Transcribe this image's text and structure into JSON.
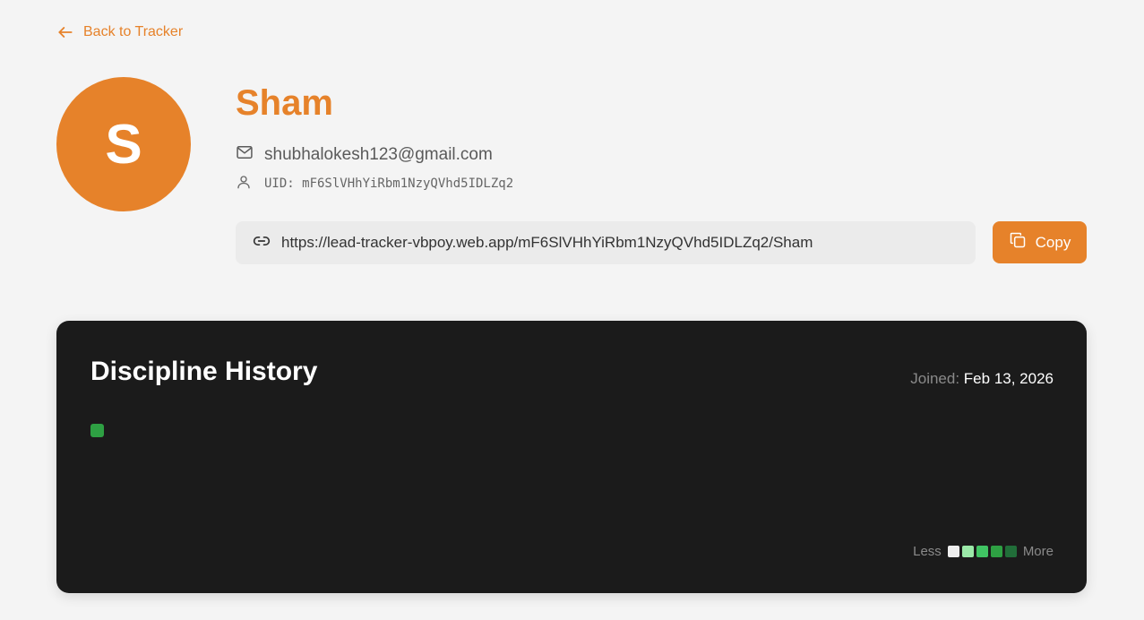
{
  "back_link": {
    "label": "Back to Tracker",
    "icon": "arrow-left-icon"
  },
  "profile": {
    "avatar_initial": "S",
    "name": "Sham",
    "email": "shubhalokesh123@gmail.com",
    "uid_text": "UID: mF6SlVHhYiRbm1NzyQVhd5IDLZq2"
  },
  "share": {
    "url": "https://lead-tracker-vbpoy.web.app/mF6SlVHhYiRbm1NzyQVhd5IDLZq2/Sham",
    "copy_label": "Copy"
  },
  "history": {
    "title": "Discipline History",
    "joined_label": "Joined:",
    "joined_date": "Feb 13, 2026",
    "legend_less": "Less",
    "legend_more": "More",
    "legend_colors": [
      "#eeeeee",
      "#9be9a8",
      "#40c463",
      "#2ea043",
      "#216e39"
    ],
    "active_cell_color": "#2ea043"
  },
  "colors": {
    "accent": "#e6822a",
    "card_bg": "#1b1b1b",
    "page_bg": "#f4f4f4"
  }
}
